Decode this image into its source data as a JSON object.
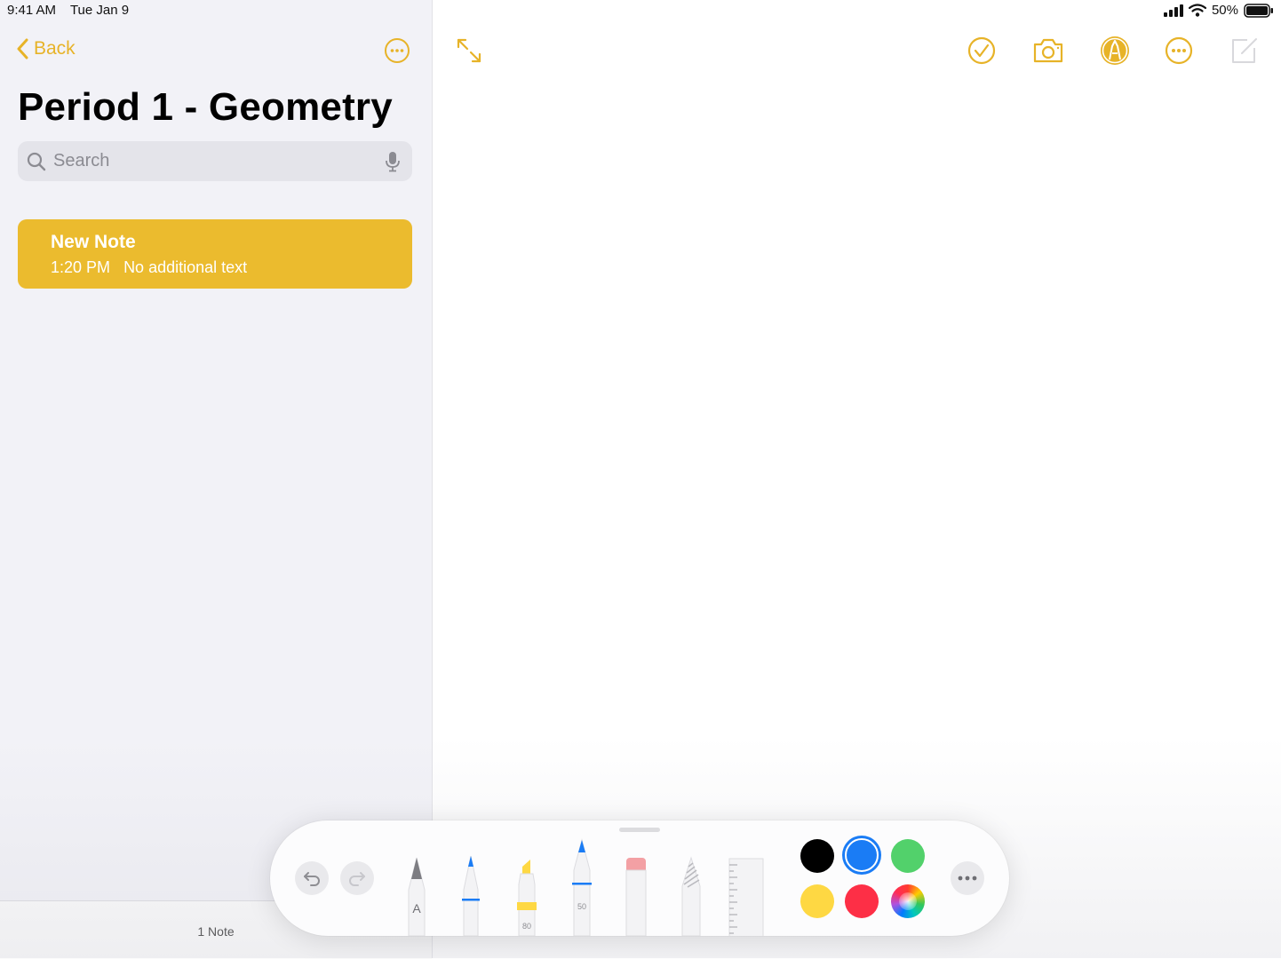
{
  "status": {
    "time": "9:41 AM",
    "date": "Tue Jan 9",
    "battery": "50%"
  },
  "sidebar": {
    "back_label": "Back",
    "folder_title": "Period 1 - Geometry",
    "search_placeholder": "Search",
    "notes": [
      {
        "title": "New Note",
        "time": "1:20 PM",
        "preview": "No additional text"
      }
    ],
    "footer_count": "1 Note"
  },
  "toolbar": {
    "icons": [
      "expand-icon",
      "checklist-icon",
      "camera-icon",
      "markup-icon",
      "more-icon",
      "compose-icon"
    ]
  },
  "palette": {
    "tools": [
      {
        "name": "pen",
        "label": "A"
      },
      {
        "name": "marker",
        "label": ""
      },
      {
        "name": "highlighter",
        "label": "80"
      },
      {
        "name": "pencil",
        "label": "50"
      },
      {
        "name": "eraser",
        "label": ""
      },
      {
        "name": "lasso",
        "label": ""
      },
      {
        "name": "ruler",
        "label": ""
      }
    ],
    "colors": [
      "#000000",
      "#1a7cf5",
      "#52d16b",
      "#fed843",
      "#fd2f46",
      "spectrum"
    ],
    "selected_color": "#1a7cf5"
  },
  "colors": {
    "accent": "#e7b328",
    "note_selected": "#ebbb2e"
  }
}
